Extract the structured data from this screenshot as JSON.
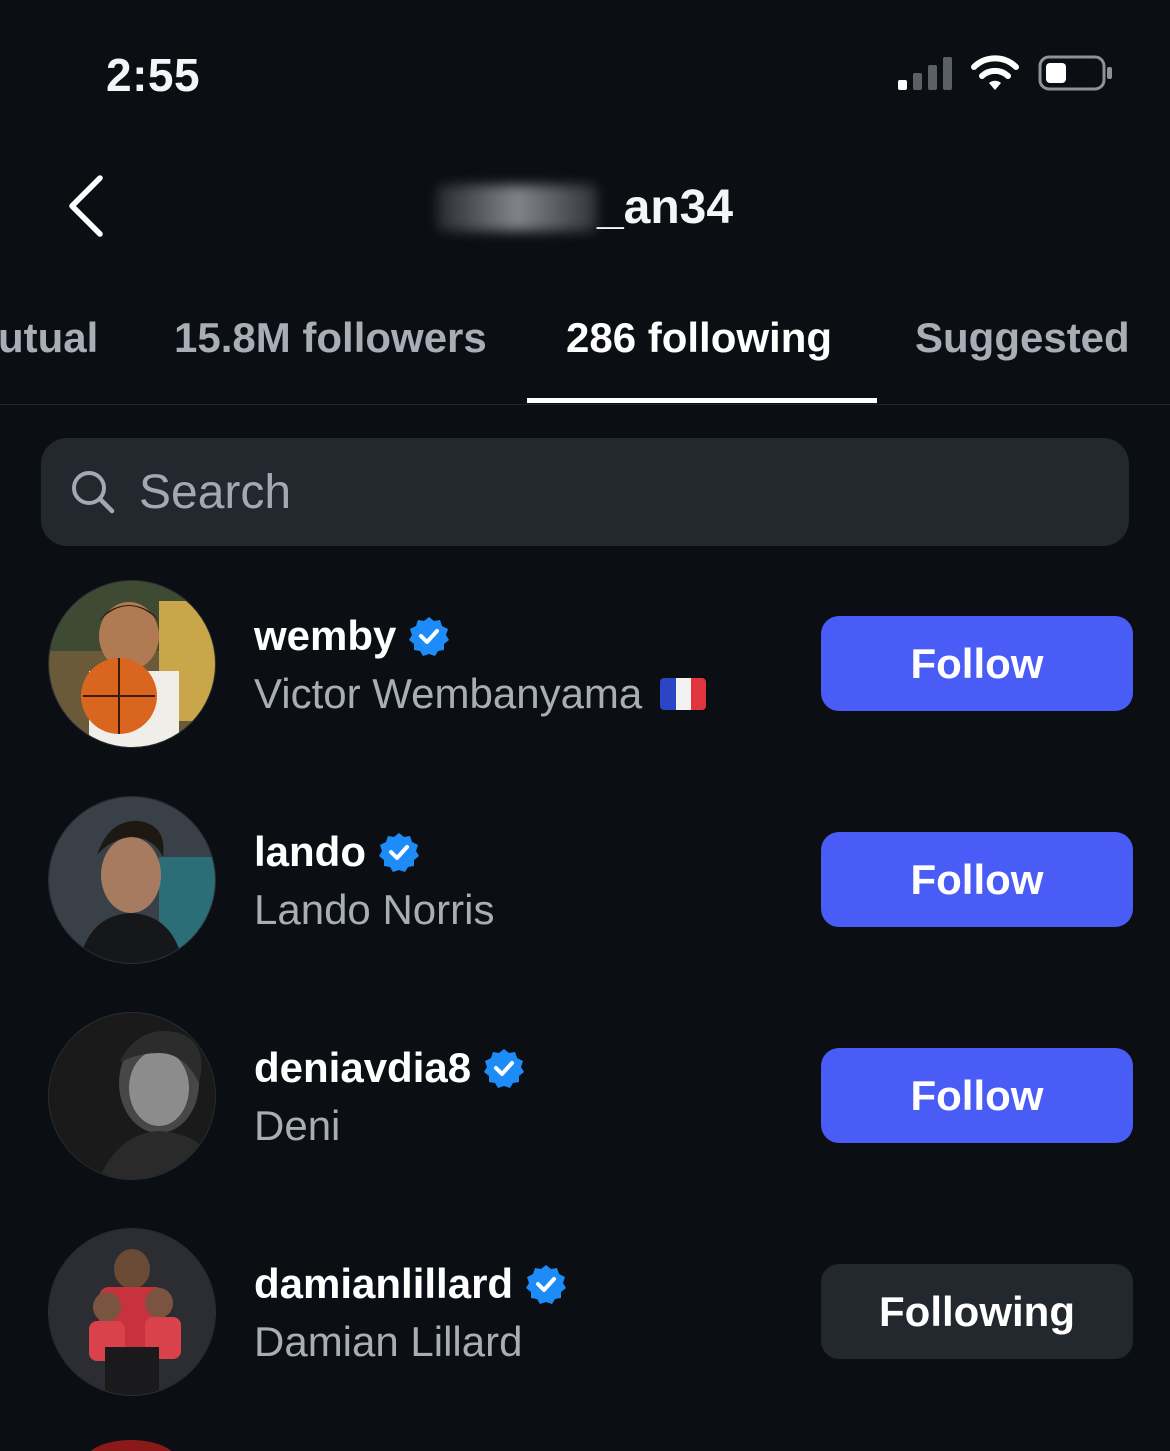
{
  "status_bar": {
    "time": "2:55"
  },
  "header": {
    "username_visible": "_an34"
  },
  "tabs": [
    {
      "label": "utual"
    },
    {
      "label": "15.8M followers"
    },
    {
      "label": "286 following",
      "active": true
    },
    {
      "label": "Suggested"
    }
  ],
  "search": {
    "placeholder": "Search",
    "value": ""
  },
  "users": [
    {
      "username": "wemby",
      "full_name": "Victor Wembanyama",
      "verified": true,
      "button": "Follow",
      "flag": "france-flag"
    },
    {
      "username": "lando",
      "full_name": "Lando Norris",
      "verified": true,
      "button": "Follow"
    },
    {
      "username": "deniavdia8",
      "full_name": "Deni",
      "verified": true,
      "button": "Follow"
    },
    {
      "username": "damianlillard",
      "full_name": "Damian Lillard",
      "verified": true,
      "button": "Following"
    }
  ],
  "colors": {
    "background": "#0b0f14",
    "follow_button": "#4a5cf6",
    "following_button": "#23272e",
    "verified_badge": "#1d8cf8"
  }
}
